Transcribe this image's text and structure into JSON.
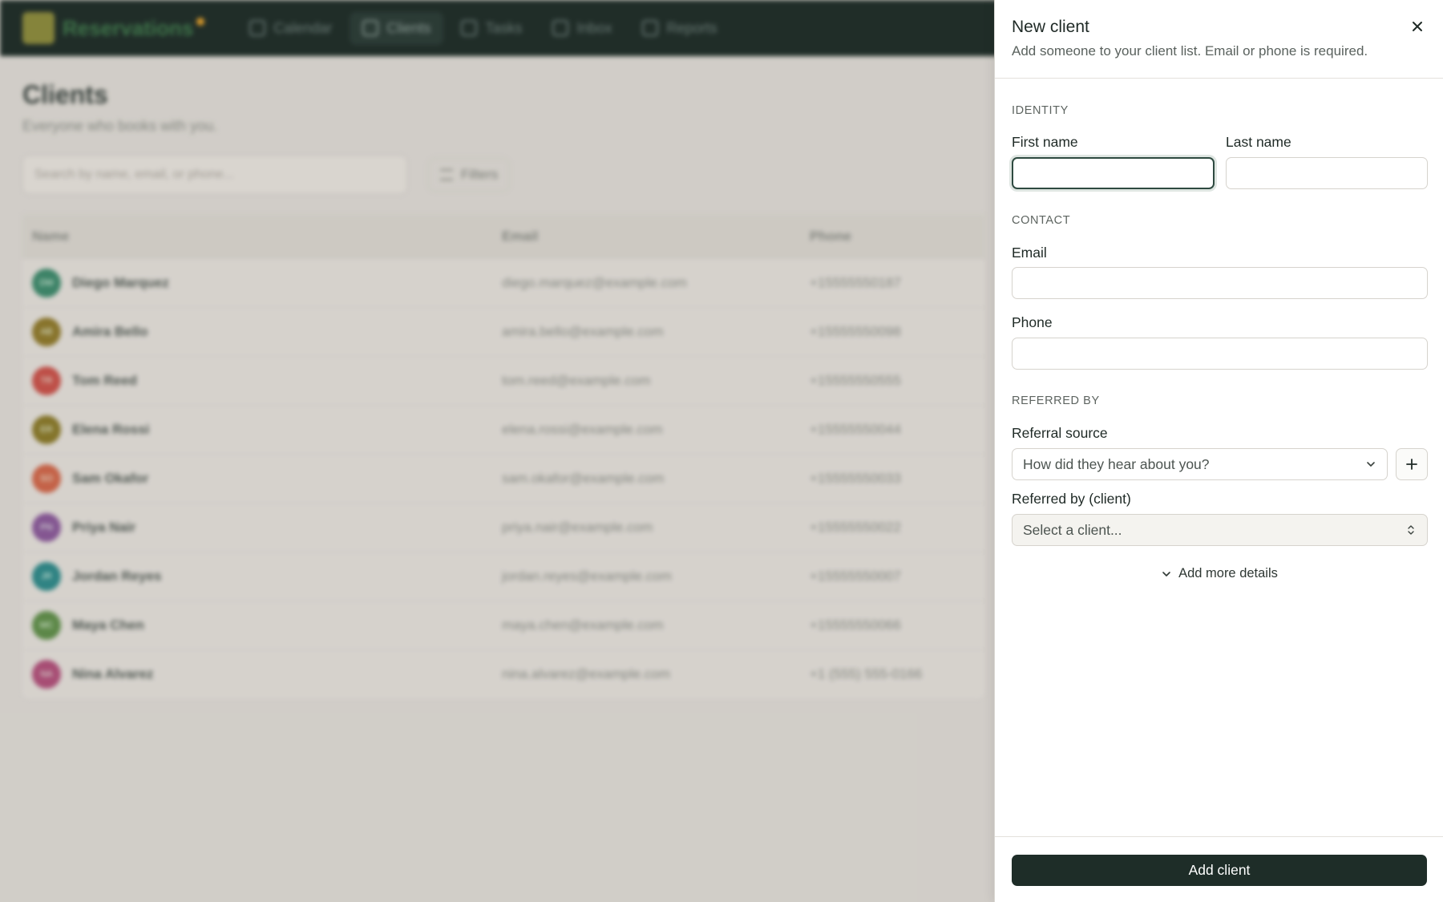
{
  "app": {
    "brand": "Reservations",
    "nav": [
      {
        "label": "Calendar"
      },
      {
        "label": "Clients"
      },
      {
        "label": "Tasks"
      },
      {
        "label": "Inbox"
      },
      {
        "label": "Reports"
      }
    ],
    "page_title": "Clients",
    "page_subtitle": "Everyone who books with you.",
    "search_placeholder": "Search by name, email, or phone...",
    "filters_label": "Filters",
    "columns": [
      "Name",
      "Email",
      "Phone"
    ],
    "rows": [
      {
        "initials": "DM",
        "name": "Diego Marquez",
        "email": "diego.marquez@example.com",
        "phone": "+15555550187",
        "color": "#3d8a6c"
      },
      {
        "initials": "AB",
        "name": "Amira Bello",
        "email": "amira.bello@example.com",
        "phone": "+15555550098",
        "color": "#8f7a2c"
      },
      {
        "initials": "TR",
        "name": "Tom Reed",
        "email": "tom.reed@example.com",
        "phone": "+15555550555",
        "color": "#c9524a"
      },
      {
        "initials": "ER",
        "name": "Elena Rossi",
        "email": "elena.rossi@example.com",
        "phone": "+15555550044",
        "color": "#8a7a2a"
      },
      {
        "initials": "SO",
        "name": "Sam Okafor",
        "email": "sam.okafor@example.com",
        "phone": "+15555550033",
        "color": "#d0674a"
      },
      {
        "initials": "PN",
        "name": "Priya Nair",
        "email": "priya.nair@example.com",
        "phone": "+15555550022",
        "color": "#8a5a9a"
      },
      {
        "initials": "JR",
        "name": "Jordan Reyes",
        "email": "jordan.reyes@example.com",
        "phone": "+15555550007",
        "color": "#2e8a8a"
      },
      {
        "initials": "MC",
        "name": "Maya Chen",
        "email": "maya.chen@example.com",
        "phone": "+15555550066",
        "color": "#5f8f4a"
      },
      {
        "initials": "NA",
        "name": "Nina Alvarez",
        "email": "nina.alvarez@example.com",
        "phone": "+1 (555) 555-0166",
        "color": "#b0507a"
      }
    ]
  },
  "panel": {
    "title": "New client",
    "subtitle": "Add someone to your client list. Email or phone is required.",
    "sections": {
      "identity": "IDENTITY",
      "contact": "CONTACT",
      "referred_by": "REFERRED BY"
    },
    "fields": {
      "first_name": {
        "label": "First name",
        "value": ""
      },
      "last_name": {
        "label": "Last name",
        "value": ""
      },
      "email": {
        "label": "Email",
        "value": ""
      },
      "phone": {
        "label": "Phone",
        "value": ""
      },
      "referral_source": {
        "label": "Referral source",
        "placeholder": "How did they hear about you?"
      },
      "referred_by_client": {
        "label": "Referred by (client)",
        "placeholder": "Select a client..."
      }
    },
    "more_details_label": "Add more details",
    "submit_label": "Add client"
  }
}
